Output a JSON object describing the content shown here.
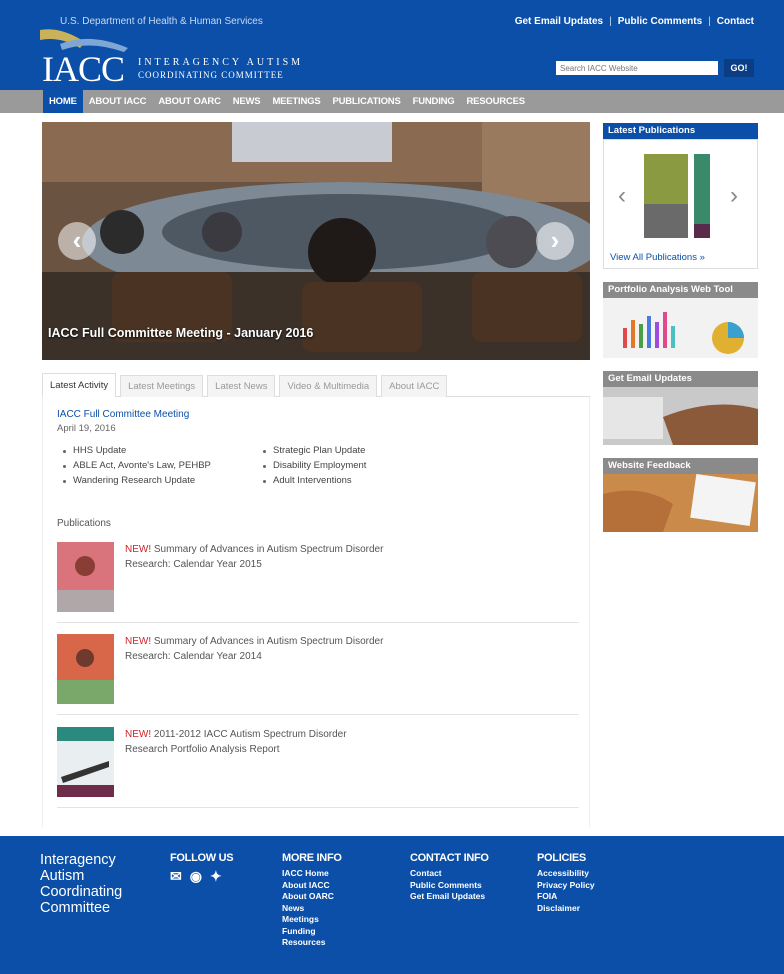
{
  "header": {
    "hhs": "U.S. Department of Health & Human Services",
    "top_links": [
      "Get Email Updates",
      "Public Comments",
      "Contact"
    ],
    "logo": {
      "main": "IACC",
      "line1": "INTERAGENCY AUTISM",
      "line2": "COORDINATING COMMITTEE"
    },
    "search_placeholder": "Search IACC Website",
    "go_label": "GO!"
  },
  "nav": [
    "HOME",
    "ABOUT IACC",
    "ABOUT OARC",
    "NEWS",
    "MEETINGS",
    "PUBLICATIONS",
    "FUNDING",
    "RESOURCES"
  ],
  "hero": {
    "caption": "IACC Full Committee Meeting - January 2016"
  },
  "tabs": [
    "Latest Activity",
    "Latest Meetings",
    "Latest News",
    "Video & Multimedia",
    "About IACC"
  ],
  "activity": {
    "title": "IACC Full Committee Meeting",
    "date": "April 19, 2016",
    "bullets": [
      "HHS Update",
      "Strategic Plan Update",
      "ABLE Act, Avonte's Law, PEHBP",
      "Disability Employment",
      "Wandering Research Update",
      "Adult Interventions"
    ],
    "publications_heading": "Publications",
    "publications": [
      {
        "new": "NEW!",
        "text": " Summary of Advances in Autism Spectrum Disorder Research: Calendar Year 2015"
      },
      {
        "new": "NEW!",
        "text": " Summary of Advances in Autism Spectrum Disorder Research: Calendar Year 2014"
      },
      {
        "new": "NEW!",
        "text": " 2011-2012 IACC Autism Spectrum Disorder Research Portfolio Analysis Report"
      }
    ]
  },
  "sidebar": {
    "latest_publications": "Latest Publications",
    "view_all": "View All Publications »",
    "portfolio": "Portfolio Analysis Web Tool",
    "email": "Get Email Updates",
    "feedback": "Website Feedback"
  },
  "footer": {
    "title": "Interagency Autism Coordinating Committee",
    "follow": "FOLLOW US",
    "more_info": {
      "head": "MORE INFO",
      "links": [
        "IACC Home",
        "About IACC",
        "About OARC",
        "News",
        "Meetings",
        "Funding",
        "Resources"
      ]
    },
    "contact": {
      "head": "CONTACT INFO",
      "links": [
        "Contact",
        "Public Comments",
        "Get Email Updates"
      ]
    },
    "policies": {
      "head": "POLICIES",
      "links": [
        "Accessibility",
        "Privacy Policy",
        "FOIA",
        "Disclaimer"
      ]
    }
  }
}
